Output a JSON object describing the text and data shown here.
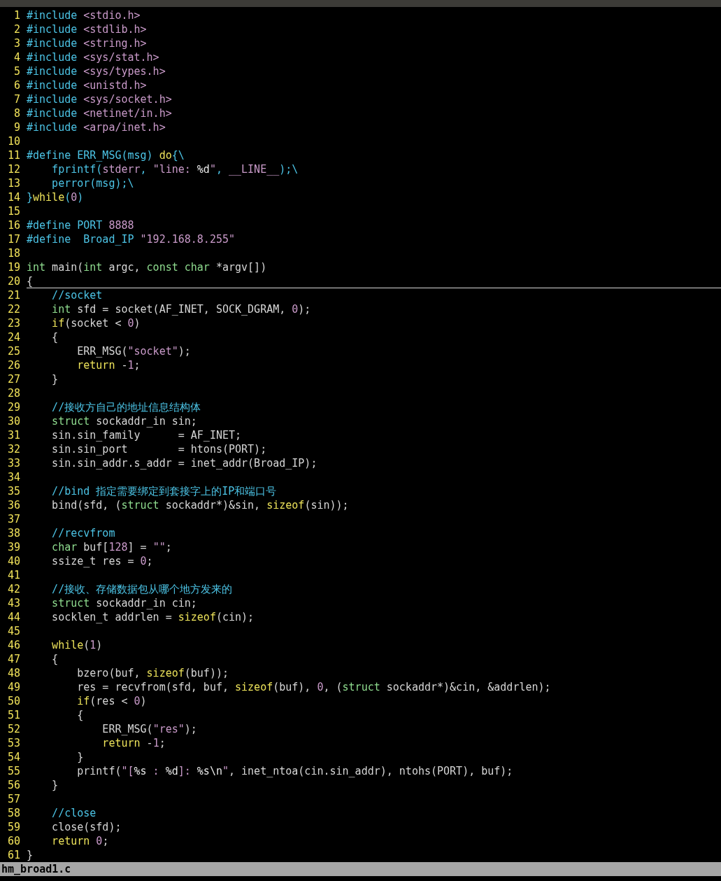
{
  "editor": {
    "lines": [
      {
        "number": "1",
        "cursor": false,
        "tokens": [
          {
            "kind": "preproc",
            "text": "#include "
          },
          {
            "kind": "string",
            "text": "<stdio.h>"
          }
        ]
      },
      {
        "number": "2",
        "cursor": false,
        "tokens": [
          {
            "kind": "preproc",
            "text": "#include "
          },
          {
            "kind": "string",
            "text": "<stdlib.h>"
          }
        ]
      },
      {
        "number": "3",
        "cursor": false,
        "tokens": [
          {
            "kind": "preproc",
            "text": "#include "
          },
          {
            "kind": "string",
            "text": "<string.h>"
          }
        ]
      },
      {
        "number": "4",
        "cursor": false,
        "tokens": [
          {
            "kind": "preproc",
            "text": "#include "
          },
          {
            "kind": "string",
            "text": "<sys/stat.h>"
          }
        ]
      },
      {
        "number": "5",
        "cursor": false,
        "tokens": [
          {
            "kind": "preproc",
            "text": "#include "
          },
          {
            "kind": "string",
            "text": "<sys/types.h>"
          }
        ]
      },
      {
        "number": "6",
        "cursor": false,
        "tokens": [
          {
            "kind": "preproc",
            "text": "#include "
          },
          {
            "kind": "string",
            "text": "<unistd.h>"
          }
        ]
      },
      {
        "number": "7",
        "cursor": false,
        "tokens": [
          {
            "kind": "preproc",
            "text": "#include "
          },
          {
            "kind": "string",
            "text": "<sys/socket.h>"
          }
        ]
      },
      {
        "number": "8",
        "cursor": false,
        "tokens": [
          {
            "kind": "preproc",
            "text": "#include "
          },
          {
            "kind": "string",
            "text": "<netinet/in.h>"
          }
        ]
      },
      {
        "number": "9",
        "cursor": false,
        "tokens": [
          {
            "kind": "preproc",
            "text": "#include "
          },
          {
            "kind": "string",
            "text": "<arpa/inet.h>"
          }
        ]
      },
      {
        "number": "10",
        "cursor": false
      },
      {
        "number": "11",
        "cursor": false,
        "tokens": [
          {
            "kind": "preproc",
            "text": "#define ERR_MSG(msg) "
          },
          {
            "kind": "keyword",
            "text": "do"
          },
          {
            "kind": "preproc",
            "text": "{\\"
          }
        ]
      },
      {
        "number": "12",
        "cursor": false,
        "tokens": [
          {
            "kind": "preproc",
            "text": "    fprintf("
          },
          {
            "kind": "string",
            "text": "stderr"
          },
          {
            "kind": "preproc",
            "text": ", "
          },
          {
            "kind": "string",
            "text": "\"line: "
          },
          {
            "kind": "special",
            "text": "%d"
          },
          {
            "kind": "string",
            "text": "\""
          },
          {
            "kind": "preproc",
            "text": ", "
          },
          {
            "kind": "string",
            "text": "__LINE__"
          },
          {
            "kind": "preproc",
            "text": ");\\"
          }
        ]
      },
      {
        "number": "13",
        "cursor": false,
        "tokens": [
          {
            "kind": "preproc",
            "text": "    perror(msg);\\"
          }
        ]
      },
      {
        "number": "14",
        "cursor": false,
        "tokens": [
          {
            "kind": "preproc",
            "text": "}"
          },
          {
            "kind": "keyword",
            "text": "while"
          },
          {
            "kind": "preproc",
            "text": "("
          },
          {
            "kind": "number",
            "text": "0"
          },
          {
            "kind": "preproc",
            "text": ")"
          }
        ]
      },
      {
        "number": "15",
        "cursor": false
      },
      {
        "number": "16",
        "cursor": false,
        "tokens": [
          {
            "kind": "preproc",
            "text": "#define PORT "
          },
          {
            "kind": "number",
            "text": "8888"
          }
        ]
      },
      {
        "number": "17",
        "cursor": false,
        "tokens": [
          {
            "kind": "preproc",
            "text": "#define  Broad_IP "
          },
          {
            "kind": "string",
            "text": "\"192.168.8.255\""
          }
        ]
      },
      {
        "number": "18",
        "cursor": false
      },
      {
        "number": "19",
        "cursor": false,
        "tokens": [
          {
            "kind": "type",
            "text": "int"
          },
          {
            "kind": "plain",
            "text": " main("
          },
          {
            "kind": "type",
            "text": "int"
          },
          {
            "kind": "plain",
            "text": " argc, "
          },
          {
            "kind": "type",
            "text": "const "
          },
          {
            "kind": "type",
            "text": "char"
          },
          {
            "kind": "plain",
            "text": " *argv[])"
          }
        ]
      },
      {
        "number": "20",
        "cursor": true,
        "tokens": [
          {
            "kind": "plain",
            "text": "{"
          }
        ]
      },
      {
        "number": "21",
        "cursor": false,
        "tokens": [
          {
            "kind": "comment",
            "text": "    //socket"
          }
        ]
      },
      {
        "number": "22",
        "cursor": false,
        "tokens": [
          {
            "kind": "type",
            "text": "    int"
          },
          {
            "kind": "plain",
            "text": " sfd = socket(AF_INET, SOCK_DGRAM, "
          },
          {
            "kind": "number",
            "text": "0"
          },
          {
            "kind": "plain",
            "text": ");"
          }
        ]
      },
      {
        "number": "23",
        "cursor": false,
        "tokens": [
          {
            "kind": "keyword",
            "text": "    if"
          },
          {
            "kind": "plain",
            "text": "(socket < "
          },
          {
            "kind": "number",
            "text": "0"
          },
          {
            "kind": "plain",
            "text": ")"
          }
        ]
      },
      {
        "number": "24",
        "cursor": false,
        "tokens": [
          {
            "kind": "plain",
            "text": "    {"
          }
        ]
      },
      {
        "number": "25",
        "cursor": false,
        "tokens": [
          {
            "kind": "plain",
            "text": "        ERR_MSG("
          },
          {
            "kind": "string",
            "text": "\"socket\""
          },
          {
            "kind": "plain",
            "text": ");"
          }
        ]
      },
      {
        "number": "26",
        "cursor": false,
        "tokens": [
          {
            "kind": "keyword",
            "text": "        return"
          },
          {
            "kind": "plain",
            "text": " -"
          },
          {
            "kind": "number",
            "text": "1"
          },
          {
            "kind": "plain",
            "text": ";"
          }
        ]
      },
      {
        "number": "27",
        "cursor": false,
        "tokens": [
          {
            "kind": "plain",
            "text": "    }"
          }
        ]
      },
      {
        "number": "28",
        "cursor": false
      },
      {
        "number": "29",
        "cursor": false,
        "tokens": [
          {
            "kind": "comment",
            "text": "    //接收方自己的地址信息结构体"
          }
        ]
      },
      {
        "number": "30",
        "cursor": false,
        "tokens": [
          {
            "kind": "type",
            "text": "    struct"
          },
          {
            "kind": "plain",
            "text": " sockaddr_in sin;"
          }
        ]
      },
      {
        "number": "31",
        "cursor": false,
        "tokens": [
          {
            "kind": "plain",
            "text": "    sin.sin_family      = AF_INET;"
          }
        ]
      },
      {
        "number": "32",
        "cursor": false,
        "tokens": [
          {
            "kind": "plain",
            "text": "    sin.sin_port        = htons(PORT);"
          }
        ]
      },
      {
        "number": "33",
        "cursor": false,
        "tokens": [
          {
            "kind": "plain",
            "text": "    sin.sin_addr.s_addr = inet_addr(Broad_IP);"
          }
        ]
      },
      {
        "number": "34",
        "cursor": false
      },
      {
        "number": "35",
        "cursor": false,
        "tokens": [
          {
            "kind": "comment",
            "text": "    //bind 指定需要绑定到套接字上的IP和端口号"
          }
        ]
      },
      {
        "number": "36",
        "cursor": false,
        "tokens": [
          {
            "kind": "plain",
            "text": "    bind(sfd, ("
          },
          {
            "kind": "type",
            "text": "struct"
          },
          {
            "kind": "plain",
            "text": " sockaddr*)&sin, "
          },
          {
            "kind": "keyword",
            "text": "sizeof"
          },
          {
            "kind": "plain",
            "text": "(sin));"
          }
        ]
      },
      {
        "number": "37",
        "cursor": false
      },
      {
        "number": "38",
        "cursor": false,
        "tokens": [
          {
            "kind": "comment",
            "text": "    //recvfrom"
          }
        ]
      },
      {
        "number": "39",
        "cursor": false,
        "tokens": [
          {
            "kind": "type",
            "text": "    char"
          },
          {
            "kind": "plain",
            "text": " buf["
          },
          {
            "kind": "number",
            "text": "128"
          },
          {
            "kind": "plain",
            "text": "] = "
          },
          {
            "kind": "string",
            "text": "\"\""
          },
          {
            "kind": "plain",
            "text": ";"
          }
        ]
      },
      {
        "number": "40",
        "cursor": false,
        "tokens": [
          {
            "kind": "plain",
            "text": "    ssize_t res = "
          },
          {
            "kind": "number",
            "text": "0"
          },
          {
            "kind": "plain",
            "text": ";"
          }
        ]
      },
      {
        "number": "41",
        "cursor": false
      },
      {
        "number": "42",
        "cursor": false,
        "tokens": [
          {
            "kind": "comment",
            "text": "    //接收、存储数据包从哪个地方发来的"
          }
        ]
      },
      {
        "number": "43",
        "cursor": false,
        "tokens": [
          {
            "kind": "type",
            "text": "    struct"
          },
          {
            "kind": "plain",
            "text": " sockaddr_in cin;"
          }
        ]
      },
      {
        "number": "44",
        "cursor": false,
        "tokens": [
          {
            "kind": "plain",
            "text": "    socklen_t addrlen = "
          },
          {
            "kind": "keyword",
            "text": "sizeof"
          },
          {
            "kind": "plain",
            "text": "(cin);"
          }
        ]
      },
      {
        "number": "45",
        "cursor": false
      },
      {
        "number": "46",
        "cursor": false,
        "tokens": [
          {
            "kind": "keyword",
            "text": "    while"
          },
          {
            "kind": "plain",
            "text": "("
          },
          {
            "kind": "number",
            "text": "1"
          },
          {
            "kind": "plain",
            "text": ")"
          }
        ]
      },
      {
        "number": "47",
        "cursor": false,
        "tokens": [
          {
            "kind": "plain",
            "text": "    {"
          }
        ]
      },
      {
        "number": "48",
        "cursor": false,
        "tokens": [
          {
            "kind": "plain",
            "text": "        bzero(buf, "
          },
          {
            "kind": "keyword",
            "text": "sizeof"
          },
          {
            "kind": "plain",
            "text": "(buf));"
          }
        ]
      },
      {
        "number": "49",
        "cursor": false,
        "tokens": [
          {
            "kind": "plain",
            "text": "        res = recvfrom(sfd, buf, "
          },
          {
            "kind": "keyword",
            "text": "sizeof"
          },
          {
            "kind": "plain",
            "text": "(buf), "
          },
          {
            "kind": "number",
            "text": "0"
          },
          {
            "kind": "plain",
            "text": ", ("
          },
          {
            "kind": "type",
            "text": "struct"
          },
          {
            "kind": "plain",
            "text": " sockaddr*)&cin, &addrlen);"
          }
        ]
      },
      {
        "number": "50",
        "cursor": false,
        "tokens": [
          {
            "kind": "keyword",
            "text": "        if"
          },
          {
            "kind": "plain",
            "text": "(res < "
          },
          {
            "kind": "number",
            "text": "0"
          },
          {
            "kind": "plain",
            "text": ")"
          }
        ]
      },
      {
        "number": "51",
        "cursor": false,
        "tokens": [
          {
            "kind": "plain",
            "text": "        {"
          }
        ]
      },
      {
        "number": "52",
        "cursor": false,
        "tokens": [
          {
            "kind": "plain",
            "text": "            ERR_MSG("
          },
          {
            "kind": "string",
            "text": "\"res\""
          },
          {
            "kind": "plain",
            "text": ");"
          }
        ]
      },
      {
        "number": "53",
        "cursor": false,
        "tokens": [
          {
            "kind": "keyword",
            "text": "            return"
          },
          {
            "kind": "plain",
            "text": " -"
          },
          {
            "kind": "number",
            "text": "1"
          },
          {
            "kind": "plain",
            "text": ";"
          }
        ]
      },
      {
        "number": "54",
        "cursor": false,
        "tokens": [
          {
            "kind": "plain",
            "text": "        }"
          }
        ]
      },
      {
        "number": "55",
        "cursor": false,
        "tokens": [
          {
            "kind": "plain",
            "text": "        printf("
          },
          {
            "kind": "string",
            "text": "\"["
          },
          {
            "kind": "special",
            "text": "%s"
          },
          {
            "kind": "string",
            "text": " : "
          },
          {
            "kind": "special",
            "text": "%d"
          },
          {
            "kind": "string",
            "text": "]: "
          },
          {
            "kind": "special",
            "text": "%s\\n"
          },
          {
            "kind": "string",
            "text": "\""
          },
          {
            "kind": "plain",
            "text": ", inet_ntoa(cin.sin_addr), ntohs(PORT), buf);"
          }
        ]
      },
      {
        "number": "56",
        "cursor": false,
        "tokens": [
          {
            "kind": "plain",
            "text": "    }"
          }
        ]
      },
      {
        "number": "57",
        "cursor": false
      },
      {
        "number": "58",
        "cursor": false,
        "tokens": [
          {
            "kind": "comment",
            "text": "    //close"
          }
        ]
      },
      {
        "number": "59",
        "cursor": false,
        "tokens": [
          {
            "kind": "plain",
            "text": "    close(sfd);"
          }
        ]
      },
      {
        "number": "60",
        "cursor": false,
        "tokens": [
          {
            "kind": "keyword",
            "text": "    return "
          },
          {
            "kind": "number",
            "text": "0"
          },
          {
            "kind": "plain",
            "text": ";"
          }
        ]
      },
      {
        "number": "61",
        "cursor": false,
        "tokens": [
          {
            "kind": "plain",
            "text": "}"
          }
        ]
      }
    ]
  },
  "status_bar": {
    "file_name": "hm_broad1.c"
  }
}
